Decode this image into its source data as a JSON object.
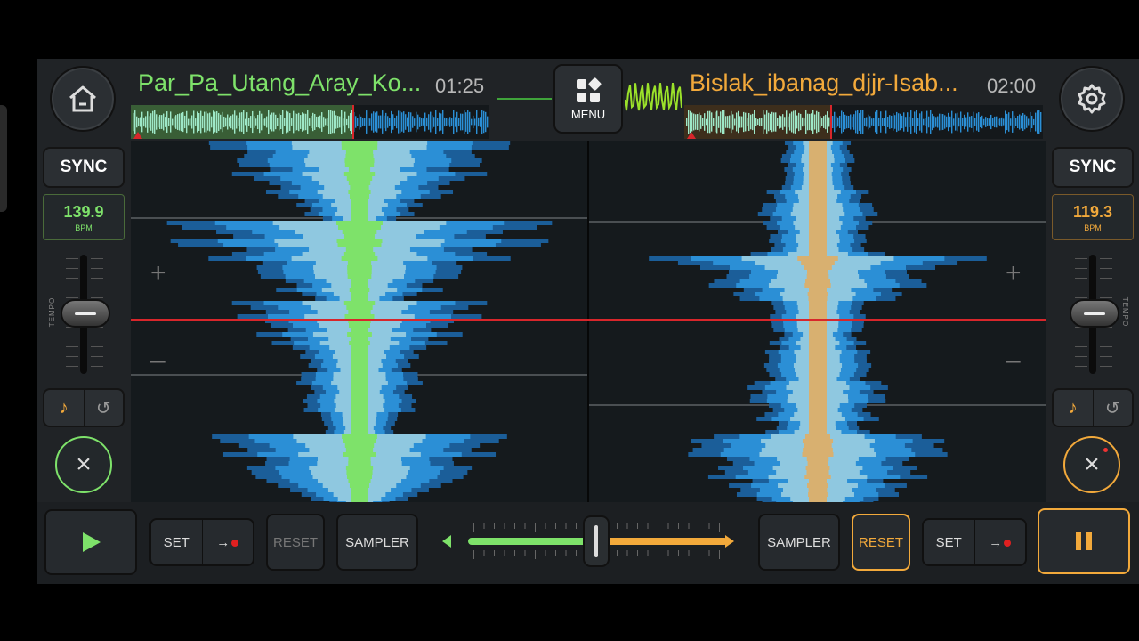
{
  "colors": {
    "deck_a": "#7ee26a",
    "deck_b": "#f2a93b",
    "wave_dark": "#1b5e99",
    "wave_mid": "#2b8fd6",
    "wave_light": "#8fc8e0",
    "cue_line": "#d8262b"
  },
  "icons": {
    "home": "home-icon",
    "menu": "grid-menu-icon",
    "settings": "gear-icon",
    "key": "music-note-icon",
    "reset_pitch": "undo-icon",
    "eject": "close-icon",
    "play": "play-icon",
    "pause": "pause-icon",
    "record": "record-arrow-icon",
    "nudge_left": "triangle-left-icon",
    "nudge_right": "triangle-right-icon"
  },
  "deck_a": {
    "title": "Par_Pa_Utang_Aray_Ko...",
    "time": "01:25",
    "sync_label": "SYNC",
    "bpm": "139.9",
    "bpm_unit": "BPM",
    "tempo_label": "TEMPO",
    "progress": 0.62,
    "pitch_plus": "+",
    "pitch_minus": "–"
  },
  "deck_b": {
    "title": "Bislak_ibanag_djjr-Isab...",
    "time": "02:00",
    "sync_label": "SYNC",
    "bpm": "119.3",
    "bpm_unit": "BPM",
    "tempo_label": "TEMPO",
    "progress": 0.41,
    "pitch_plus": "+",
    "pitch_minus": "–"
  },
  "menu": {
    "label": "MENU"
  },
  "bottom": {
    "left": {
      "set_label": "SET",
      "reset_label": "RESET",
      "sampler_label": "SAMPLER"
    },
    "right": {
      "set_label": "SET",
      "reset_label": "RESET",
      "sampler_label": "SAMPLER"
    },
    "crossfader_position": 0.5
  }
}
